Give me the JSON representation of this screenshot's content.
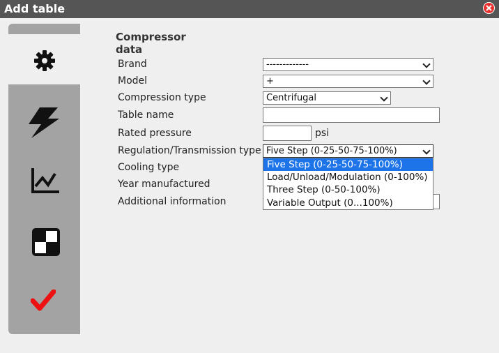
{
  "window": {
    "title": "Add table"
  },
  "section": {
    "heading": "Compressor data"
  },
  "form": {
    "brand": {
      "label": "Brand",
      "value": "-------------"
    },
    "model": {
      "label": "Model",
      "value": "+"
    },
    "compression_type": {
      "label": "Compression type",
      "value": "Centrifugal"
    },
    "table_name": {
      "label": "Table name",
      "value": ""
    },
    "rated_pressure": {
      "label": "Rated pressure",
      "value": "",
      "unit": "psi"
    },
    "regulation": {
      "label": "Regulation/Transmission type",
      "value": "Five Step (0-25-50-75-100%)",
      "options": [
        "Five Step (0-25-50-75-100%)",
        "Load/Unload/Modulation (0-100%)",
        "Three Step (0-50-100%)",
        "Variable Output (0...100%)"
      ]
    },
    "cooling_type": {
      "label": "Cooling type"
    },
    "year_manufactured": {
      "label": "Year manufactured"
    },
    "additional_information": {
      "label": "Additional information"
    }
  },
  "sidebar": {
    "tabs": [
      {
        "icon": "gear-icon",
        "active": true
      },
      {
        "icon": "lightning-icon",
        "active": false
      },
      {
        "icon": "chart-icon",
        "active": false
      },
      {
        "icon": "checker-icon",
        "active": false
      },
      {
        "icon": "check-icon",
        "active": false
      }
    ]
  },
  "colors": {
    "titlebar": "#555555",
    "sidebar": "#a3a3a3",
    "selected_option": "#1c74e8",
    "check": "#ee1111",
    "close": "#e8312f"
  }
}
